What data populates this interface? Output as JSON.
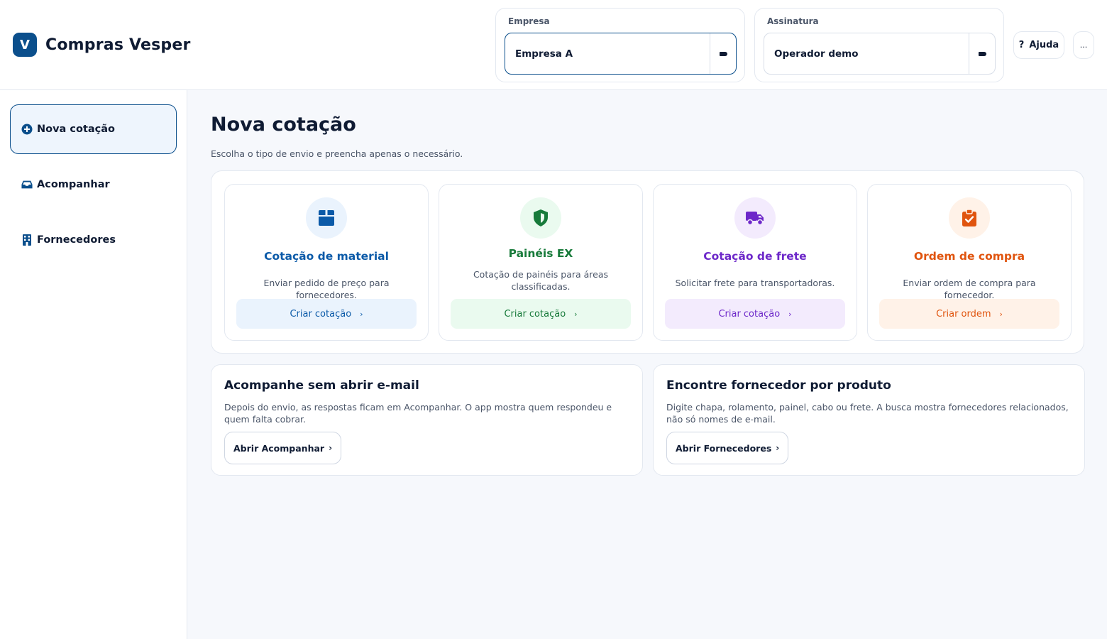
{
  "app": {
    "logo_letter": "V",
    "name": "Compras Vesper"
  },
  "header": {
    "empresa": {
      "label": "Empresa",
      "value": "Empresa A"
    },
    "assinatura": {
      "label": "Assinatura",
      "value": "Operador demo"
    },
    "help": {
      "icon": "?",
      "label": "Ajuda"
    },
    "more": {
      "label": "..."
    }
  },
  "sidebar": {
    "items": [
      {
        "label": "Nova cotação",
        "icon": "plus-circle-icon",
        "active": true
      },
      {
        "label": "Acompanhar",
        "icon": "inbox-icon",
        "active": false
      },
      {
        "label": "Fornecedores",
        "icon": "building-icon",
        "active": false
      }
    ]
  },
  "main": {
    "title": "Nova cotação",
    "subtitle": "Escolha o tipo de envio e preencha apenas o necessário.",
    "types": [
      {
        "title": "Cotação de material",
        "description": "Enviar pedido de preço para fornecedores.",
        "button": "Criar cotação",
        "chevron": "›",
        "icon": "box-icon",
        "color": "#0b5aa8",
        "tint": "#eaf3fd"
      },
      {
        "title": "Painéis EX",
        "description": "Cotação de painéis para áreas classificadas.",
        "button": "Criar cotação",
        "chevron": "›",
        "icon": "shield-icon",
        "color": "#177a3a",
        "tint": "#eafaef"
      },
      {
        "title": "Cotação de frete",
        "description": "Solicitar frete para transportadoras.",
        "button": "Criar cotação",
        "chevron": "›",
        "icon": "truck-icon",
        "color": "#6d28c9",
        "tint": "#f3ebfd"
      },
      {
        "title": "Ordem de compra",
        "description": "Enviar ordem de compra para fornecedor.",
        "button": "Criar ordem",
        "chevron": "›",
        "icon": "clipboard-check-icon",
        "color": "#e0540e",
        "tint": "#fff2e8"
      }
    ],
    "track": {
      "title": "Acompanhe sem abrir e-mail",
      "description": "Depois do envio, as respostas ficam em Acompanhar. O app mostra quem respondeu e quem falta cobrar.",
      "button": "Abrir Acompanhar",
      "chevron": "›"
    },
    "suppliers": {
      "title": "Encontre fornecedor por produto",
      "description": "Digite chapa, rolamento, painel, cabo ou frete. A busca mostra fornecedores relacionados, não só nomes de e-mail.",
      "button": "Abrir Fornecedores",
      "chevron": "›"
    }
  }
}
